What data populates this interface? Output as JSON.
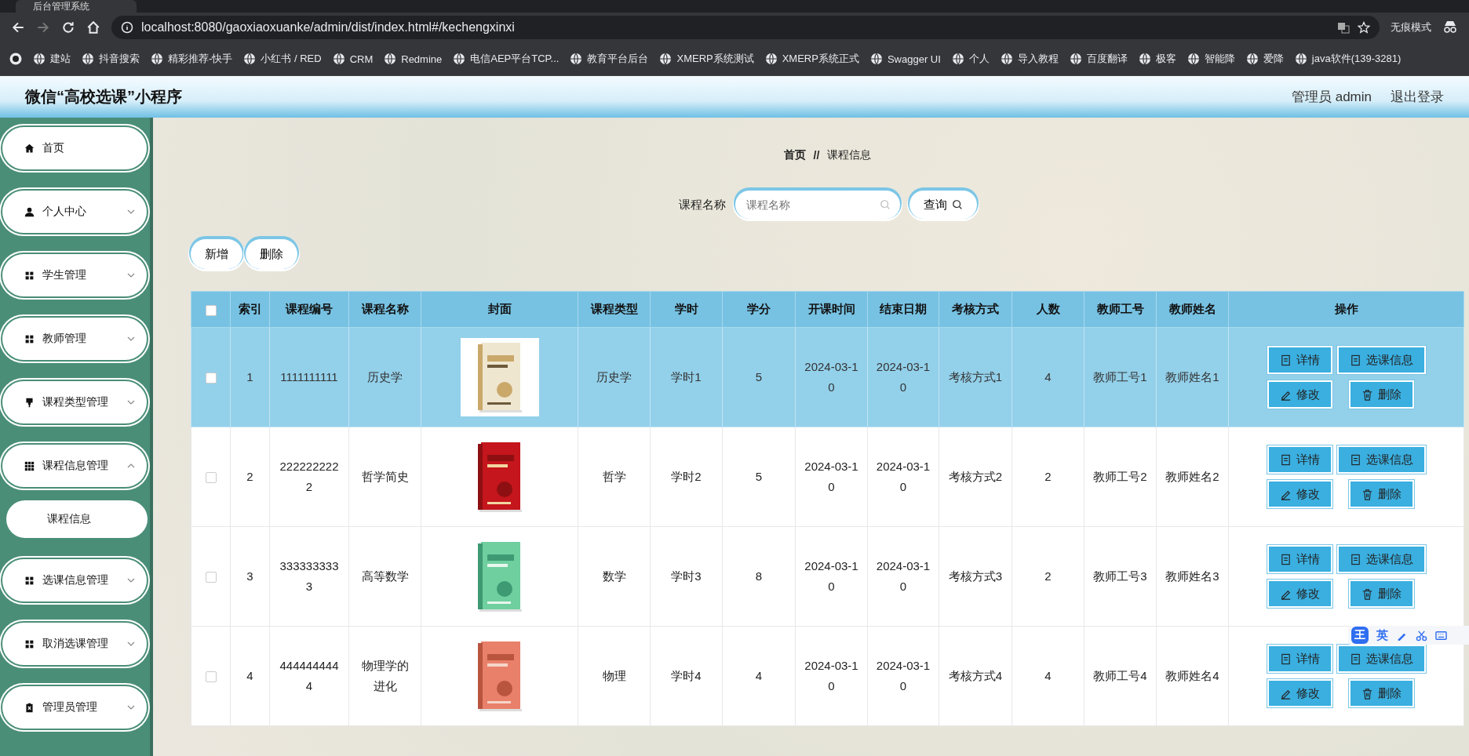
{
  "browser": {
    "tab_title": "后台管理系统",
    "url": "localhost:8080/gaoxiaoxuanke/admin/dist/index.html#/kechengxinxi",
    "profile_label": "无痕模式",
    "bookmarks": [
      {
        "label": "建站"
      },
      {
        "label": "抖音搜索"
      },
      {
        "label": "精彩推荐-快手"
      },
      {
        "label": "小红书 / RED"
      },
      {
        "label": "CRM"
      },
      {
        "label": "Redmine"
      },
      {
        "label": "电信AEP平台TCP..."
      },
      {
        "label": "教育平台后台"
      },
      {
        "label": "XMERP系统测试"
      },
      {
        "label": "XMERP系统正式"
      },
      {
        "label": "Swagger UI"
      },
      {
        "label": "个人"
      },
      {
        "label": "导入教程"
      },
      {
        "label": "百度翻译"
      },
      {
        "label": "极客"
      },
      {
        "label": "智能降"
      },
      {
        "label": "爱降"
      },
      {
        "label": "java软件(139-3281)"
      }
    ]
  },
  "header": {
    "title": "微信“高校选课”小程序",
    "user": "管理员 admin",
    "logout": "退出登录"
  },
  "sidebar": {
    "items": [
      {
        "label": "首页"
      },
      {
        "label": "个人中心",
        "expanded": false
      },
      {
        "label": "学生管理",
        "expanded": false
      },
      {
        "label": "教师管理",
        "expanded": false
      },
      {
        "label": "课程类型管理",
        "expanded": false
      },
      {
        "label": "课程信息管理",
        "expanded": true,
        "children": [
          {
            "label": "课程信息"
          }
        ]
      },
      {
        "label": "选课信息管理",
        "expanded": false
      },
      {
        "label": "取消选课管理",
        "expanded": false
      },
      {
        "label": "管理员管理",
        "expanded": false
      }
    ]
  },
  "breadcrumb": [
    "首页",
    "//",
    "课程信息"
  ],
  "search": {
    "label": "课程名称",
    "placeholder": "课程名称",
    "button": "查询"
  },
  "toolbar": [
    "新增",
    "删除"
  ],
  "table": {
    "columns": [
      "索引",
      "课程编号",
      "课程名称",
      "封面",
      "课程类型",
      "学时",
      "学分",
      "开课时间",
      "结束日期",
      "考核方式",
      "人数",
      "教师工号",
      "教师姓名",
      "操作"
    ],
    "header_checked": false,
    "rows": [
      {
        "highlighted": true,
        "checked": false,
        "cells": [
          "1",
          "1111111111",
          "历史学",
          {
            "kind": "picture"
          },
          "历史学",
          "学时1",
          "5",
          "2024-03-10",
          "2024-03-10",
          "考核方式1",
          "4",
          "教师工号1",
          "教师姓名1"
        ],
        "actions": [
          "详情",
          "选课信息",
          "修改",
          "删除"
        ]
      },
      {
        "highlighted": false,
        "checked": false,
        "cells": [
          "2",
          "2222222222",
          "哲学简史",
          {
            "kind": "picture"
          },
          "哲学",
          "学时2",
          "5",
          "2024-03-10",
          "2024-03-10",
          "考核方式2",
          "2",
          "教师工号2",
          "教师姓名2"
        ],
        "actions": [
          "详情",
          "选课信息",
          "修改",
          "删除"
        ]
      },
      {
        "highlighted": false,
        "checked": false,
        "cells": [
          "3",
          "3333333333",
          "高等数学",
          {
            "kind": "picture"
          },
          "数学",
          "学时3",
          "8",
          "2024-03-10",
          "2024-03-10",
          "考核方式3",
          "2",
          "教师工号3",
          "教师姓名3"
        ],
        "actions": [
          "详情",
          "选课信息",
          "修改",
          "删除"
        ]
      },
      {
        "highlighted": false,
        "checked": false,
        "cells": [
          "4",
          "4444444444",
          "物理学的进化",
          {
            "kind": "picture"
          },
          "物理",
          "学时4",
          "4",
          "2024-03-10",
          "2024-03-10",
          "考核方式4",
          "4",
          "教师工号4",
          "教师姓名4"
        ],
        "actions": [
          "详情",
          "选课信息",
          "修改",
          "删除"
        ]
      }
    ]
  },
  "ime_bar": {
    "mode": "王",
    "language": "英"
  }
}
